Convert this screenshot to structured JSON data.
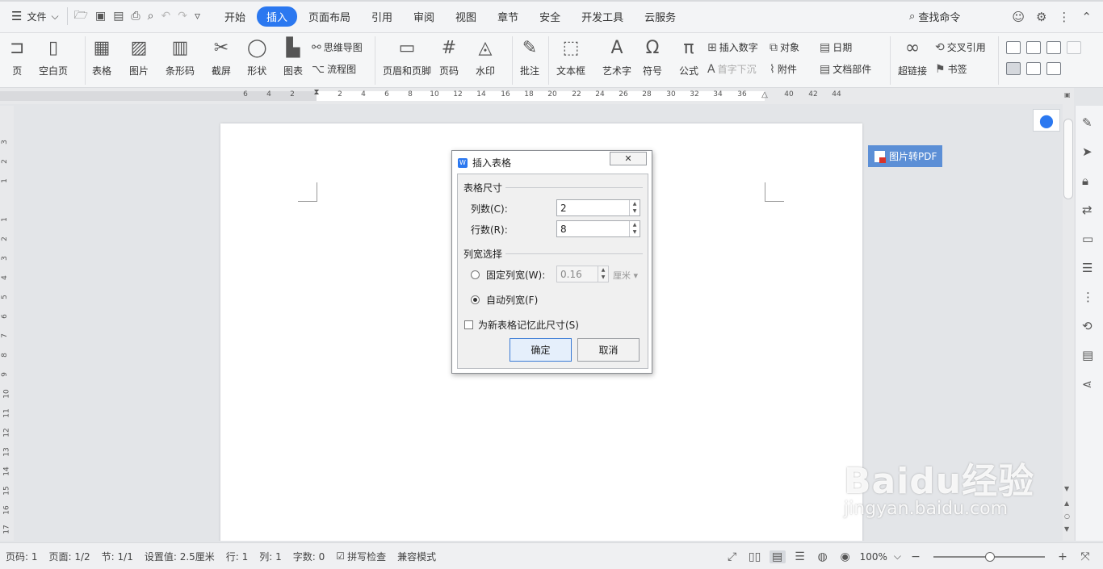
{
  "menubar": {
    "file_label": "文件",
    "tabs": [
      "开始",
      "插入",
      "页面布局",
      "引用",
      "审阅",
      "视图",
      "章节",
      "安全",
      "开发工具",
      "云服务"
    ],
    "search_label": "查找命令"
  },
  "ribbon": {
    "page_partial": "页",
    "blank_page": "空白页",
    "table": "表格",
    "picture": "图片",
    "barcode": "条形码",
    "screenshot": "截屏",
    "shape": "形状",
    "chart": "图表",
    "mindmap": "思维导图",
    "flowchart": "流程图",
    "header_footer": "页眉和页脚",
    "page_number": "页码",
    "watermark": "水印",
    "comment": "批注",
    "textbox": "文本框",
    "wordart": "艺术字",
    "symbol": "符号",
    "formula": "公式",
    "insert_number": "插入数字",
    "drop_cap": "首字下沉",
    "object": "对象",
    "attachment": "附件",
    "date": "日期",
    "doc_parts": "文档部件",
    "hyperlink": "超链接",
    "cross_ref": "交叉引用",
    "bookmark": "书签"
  },
  "ruler": {
    "h_left": [
      "6",
      "4",
      "2"
    ],
    "h_right": [
      "2",
      "4",
      "6",
      "8",
      "10",
      "12",
      "14",
      "16",
      "18",
      "20",
      "22",
      "24",
      "26",
      "28",
      "30",
      "32",
      "34",
      "36",
      "38",
      "40",
      "42",
      "44"
    ],
    "v_top": [
      "3",
      "2",
      "1"
    ],
    "v_main": [
      "1",
      "2",
      "3",
      "4",
      "5",
      "6",
      "7",
      "8",
      "9",
      "10",
      "11",
      "12",
      "13",
      "14",
      "15",
      "16",
      "17"
    ]
  },
  "side": {
    "img_to_pdf": "图片转PDF"
  },
  "dialog": {
    "title": "插入表格",
    "group_size": "表格尺寸",
    "cols_label": "列数(C):",
    "cols_value": "2",
    "rows_label": "行数(R):",
    "rows_value": "8",
    "group_width": "列宽选择",
    "fixed_label": "固定列宽(W):",
    "fixed_value": "0.16",
    "unit": "厘米",
    "auto_label": "自动列宽(F)",
    "remember_label": "为新表格记忆此尺寸(S)",
    "ok": "确定",
    "cancel": "取消"
  },
  "statusbar": {
    "page_no": "页码: 1",
    "pages": "页面: 1/2",
    "section": "节: 1/1",
    "setting": "设置值: 2.5厘米",
    "row": "行: 1",
    "col": "列: 1",
    "words": "字数: 0",
    "spell": "拼写检查",
    "compat": "兼容模式",
    "zoom": "100%"
  },
  "watermark": {
    "brand": "Baidu经验",
    "url": "jingyan.baidu.com"
  }
}
